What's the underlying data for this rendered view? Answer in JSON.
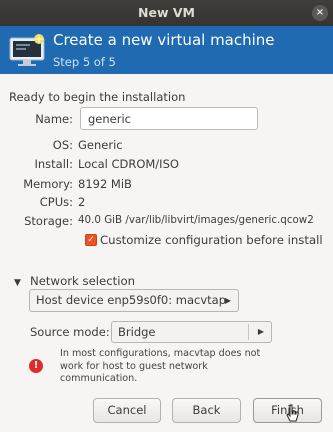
{
  "window": {
    "title": "New VM",
    "close_glyph": "×"
  },
  "header": {
    "title": "Create a new virtual machine",
    "step": "Step 5 of 5",
    "background_color": "#1f6ab1",
    "icon": "monitor-icon"
  },
  "summary": {
    "heading": "Ready to begin the installation",
    "name_label": "Name:",
    "name_value": "generic",
    "rows": [
      {
        "label": "OS:",
        "value": "Generic"
      },
      {
        "label": "Install:",
        "value": "Local CDROM/ISO"
      },
      {
        "label": "Memory:",
        "value": "8192 MiB"
      },
      {
        "label": "CPUs:",
        "value": "2"
      },
      {
        "label": "Storage:",
        "value": "40.0 GiB /var/lib/libvirt/images/generic.qcow2"
      }
    ],
    "customize_checkbox": {
      "label": "Customize configuration before install",
      "checked": true,
      "color": "#e95420"
    }
  },
  "network": {
    "expander_label": "Network selection",
    "expander_glyph": "▼",
    "host_device": "Host device enp59s0f0: macvtap",
    "source_mode_label": "Source mode:",
    "source_mode_value": "Bridge",
    "dropdown_glyph": "▶",
    "warning_glyph": "!",
    "warning_lines": [
      "In most configurations, macvtap does not",
      "work for host to guest network",
      "communication."
    ]
  },
  "buttons": {
    "cancel": "Cancel",
    "back": "Back",
    "finish": "Finish"
  }
}
